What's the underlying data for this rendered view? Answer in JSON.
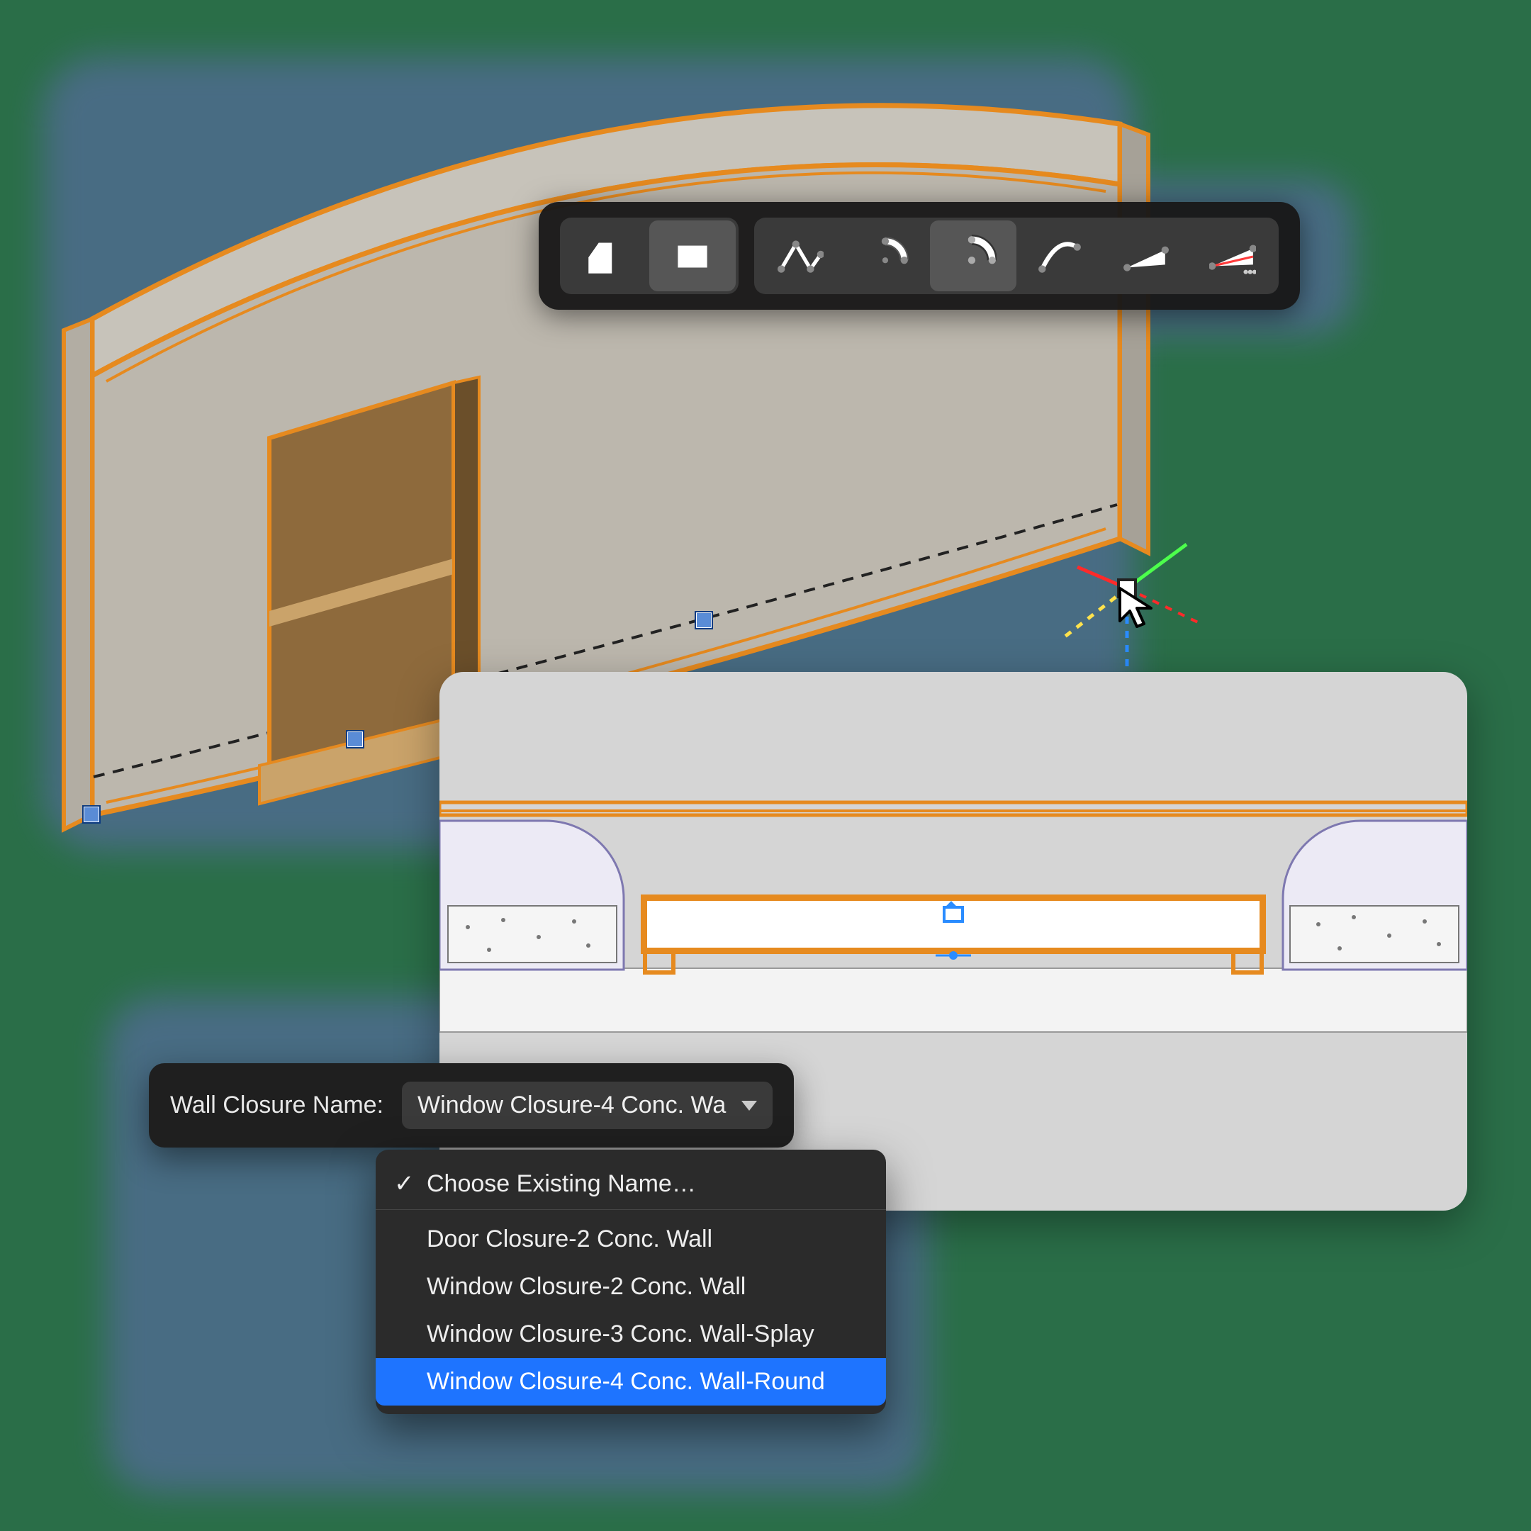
{
  "toolbar": {
    "groups": [
      {
        "name": "mode",
        "buttons": [
          {
            "id": "profile-shape",
            "selected": false,
            "icon": "profile"
          },
          {
            "id": "profile-rect",
            "selected": true,
            "icon": "rect"
          }
        ]
      },
      {
        "name": "segment",
        "buttons": [
          {
            "id": "seg-polyline",
            "selected": false,
            "icon": "poly"
          },
          {
            "id": "seg-arc-chord",
            "selected": false,
            "icon": "arc1"
          },
          {
            "id": "seg-arc-center",
            "selected": true,
            "icon": "arc2"
          },
          {
            "id": "seg-tangent",
            "selected": false,
            "icon": "tan"
          },
          {
            "id": "seg-bezier",
            "selected": false,
            "icon": "bez"
          },
          {
            "id": "seg-bezier-more",
            "selected": false,
            "icon": "bezmore"
          }
        ]
      }
    ]
  },
  "closure": {
    "label": "Wall Closure Name:",
    "value": "Window Closure-4 Conc. Wa",
    "menu_header": "Choose Existing Name…",
    "options": [
      "Door Closure-2 Conc. Wall",
      "Window Closure-2 Conc. Wall",
      "Window Closure-3 Conc. Wall-Splay",
      "Window Closure-4 Conc. Wall-Round"
    ],
    "highlighted": "Window Closure-4 Conc. Wall-Round"
  },
  "axis": {
    "colors": {
      "x": "#ff2a2a",
      "y": "#4cff4c",
      "z": "#2a8cff",
      "w": "#ffe24c"
    }
  },
  "colors": {
    "selection": "#e68a1f",
    "handle": "#5a8cd6"
  }
}
